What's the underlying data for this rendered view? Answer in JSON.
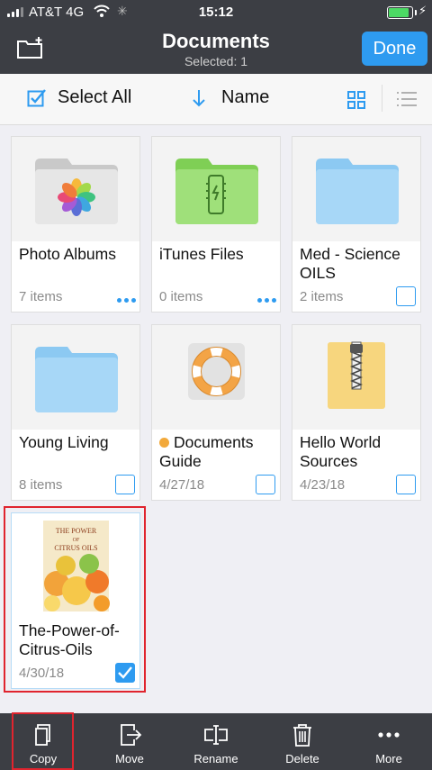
{
  "status": {
    "carrier": "AT&T 4G",
    "time": "15:12",
    "battery_percent": 90
  },
  "nav": {
    "title": "Documents",
    "subtitle": "Selected: 1",
    "done_label": "Done"
  },
  "toolbar": {
    "select_all_label": "Select All",
    "sort_label": "Name"
  },
  "items": [
    {
      "name": "Photo Albums",
      "meta": "7 items",
      "kind": "folder-photos",
      "control": "more"
    },
    {
      "name": "iTunes Files",
      "meta": "0 items",
      "kind": "folder-itunes",
      "control": "more"
    },
    {
      "name": "Med - Science OILS",
      "meta": "2 items",
      "kind": "folder",
      "control": "checkbox",
      "selected": false
    },
    {
      "name": "Young Living",
      "meta": "8 items",
      "kind": "folder",
      "control": "checkbox",
      "selected": false
    },
    {
      "name": "Documents Guide",
      "meta": "4/27/18",
      "kind": "guide-file",
      "control": "checkbox",
      "selected": false,
      "status_dot_color": "#f2a93b"
    },
    {
      "name": "Hello World Sources",
      "meta": "4/23/18",
      "kind": "zip-file",
      "control": "checkbox",
      "selected": false
    },
    {
      "name": "The-Power-of-Citrus-Oils",
      "meta": "4/30/18",
      "kind": "book-file",
      "control": "checkbox",
      "selected": true,
      "cover_text": [
        "THE POWER",
        "OF",
        "CITRUS OILS"
      ]
    }
  ],
  "bottom_bar": [
    {
      "label": "Copy",
      "icon": "copy-icon"
    },
    {
      "label": "Move",
      "icon": "move-icon"
    },
    {
      "label": "Rename",
      "icon": "rename-icon"
    },
    {
      "label": "Delete",
      "icon": "trash-icon"
    },
    {
      "label": "More",
      "icon": "more-icon"
    }
  ],
  "colors": {
    "header": "#3c3e44",
    "accent": "#2e9bf0",
    "highlight": "#e0242e",
    "folder_blue": "#a7d7f7",
    "folder_green": "#9fe07a"
  }
}
